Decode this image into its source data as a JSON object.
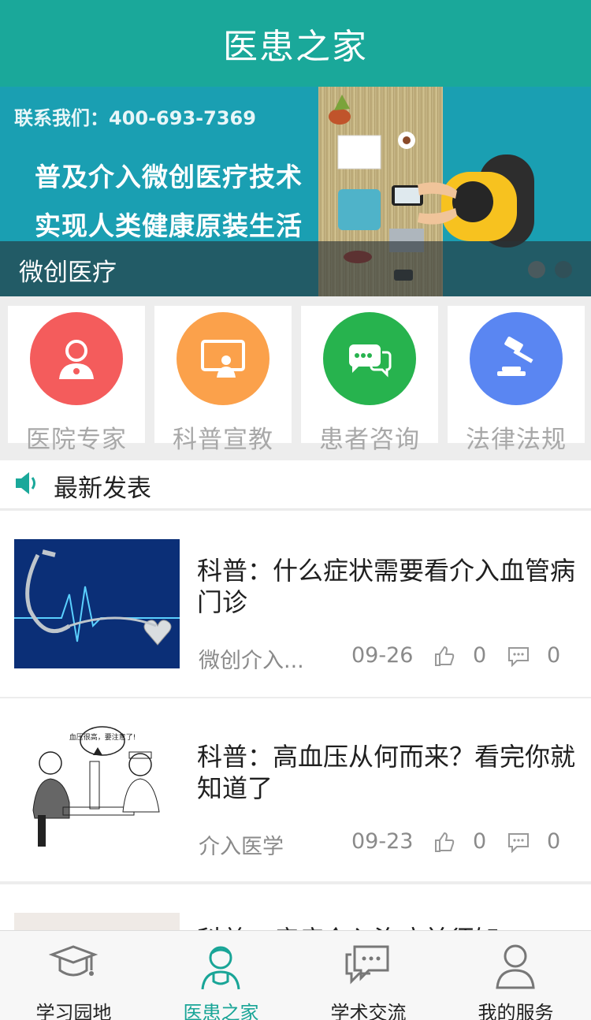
{
  "header": {
    "title": "医患之家"
  },
  "banner": {
    "contact": "联系我们：400-693-7369",
    "line1": "普及介入微创医疗技术",
    "line2": "实现人类健康原装生活",
    "caption": "微创医疗"
  },
  "categories": [
    {
      "label": "医院专家",
      "icon": "doctor-icon",
      "color": "#f45c5c"
    },
    {
      "label": "科普宣教",
      "icon": "presentation-icon",
      "color": "#fba14b"
    },
    {
      "label": "患者咨询",
      "icon": "chat-bubbles-icon",
      "color": "#27b34e"
    },
    {
      "label": "法律法规",
      "icon": "gavel-icon",
      "color": "#5a86f2"
    }
  ],
  "section": {
    "title": "最新发表",
    "icon": "speaker-icon"
  },
  "articles": [
    {
      "title": "科普：什么症状需要看介入血管病门诊",
      "source": "微创介入...",
      "date": "09-26",
      "likes": "0",
      "comments": "0"
    },
    {
      "title": "科普：高血压从何而来？看完你就知道了",
      "source": "介入医学",
      "date": "09-23",
      "likes": "0",
      "comments": "0",
      "cartoon_speech": "血压很高，要注意了!"
    },
    {
      "title": "科普：癌症介入治疗前须知"
    }
  ],
  "tabbar": {
    "items": [
      {
        "label": "学习园地",
        "icon": "graduation-cap-icon"
      },
      {
        "label": "医患之家",
        "icon": "doctor-icon",
        "active": true
      },
      {
        "label": "学术交流",
        "icon": "chat-icon"
      },
      {
        "label": "我的服务",
        "icon": "user-icon"
      }
    ],
    "active_color": "#19a597"
  }
}
